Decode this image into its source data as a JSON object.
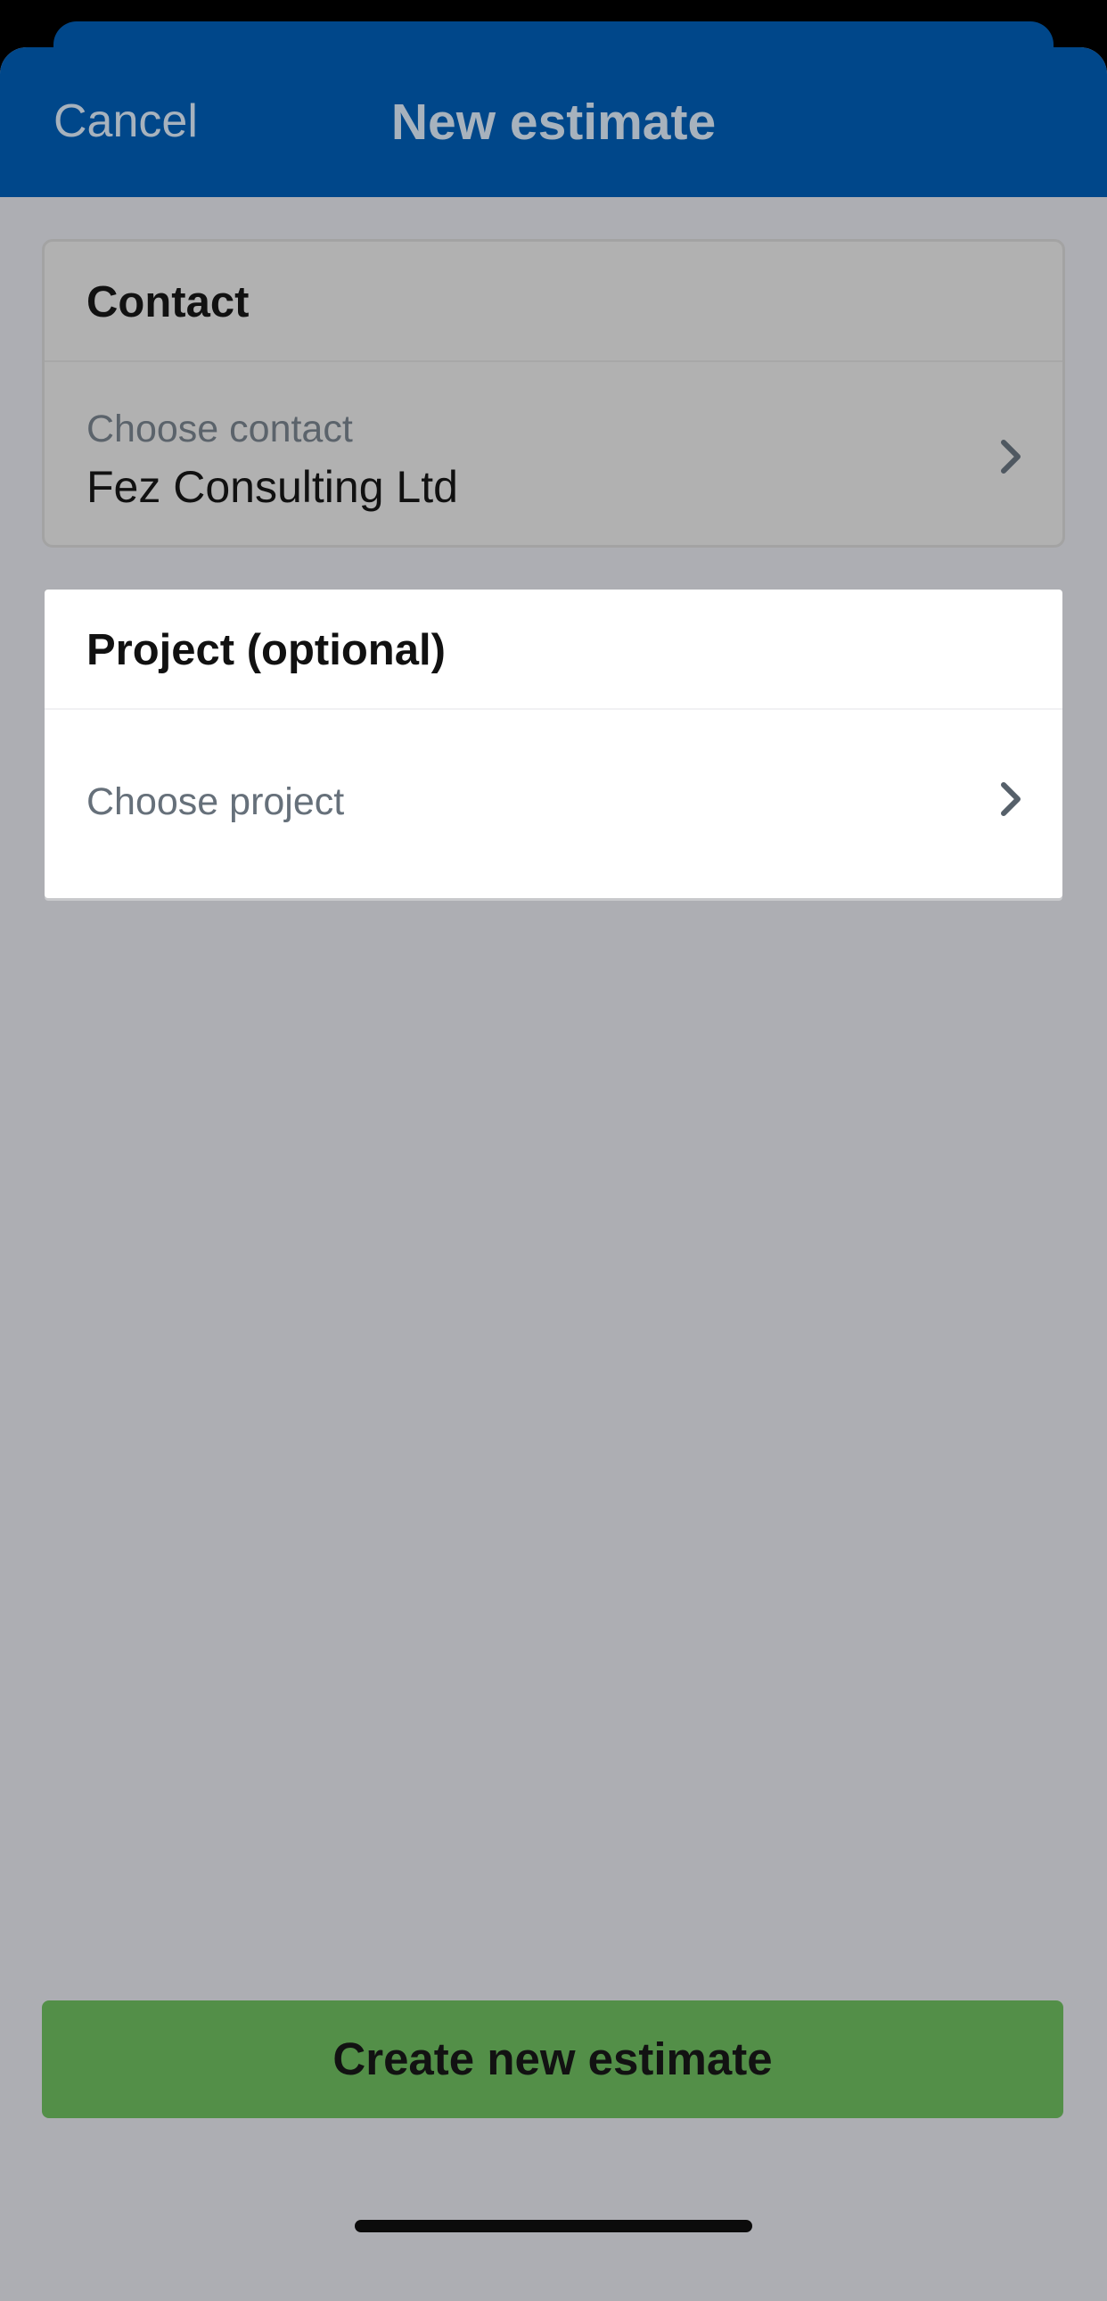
{
  "navbar": {
    "cancel_label": "Cancel",
    "title": "New estimate"
  },
  "contact_card": {
    "title": "Contact",
    "caption": "Choose contact",
    "value": "Fez Consulting Ltd",
    "chevron_icon": "chevron-right-icon"
  },
  "project_card": {
    "title": "Project (optional)",
    "placeholder": "Choose project",
    "chevron_icon": "chevron-right-icon"
  },
  "footer": {
    "create_label": "Create new estimate"
  },
  "colors": {
    "navbar": "#00478a",
    "overlay": "#adaeb3",
    "primary_button": "#538f48"
  }
}
